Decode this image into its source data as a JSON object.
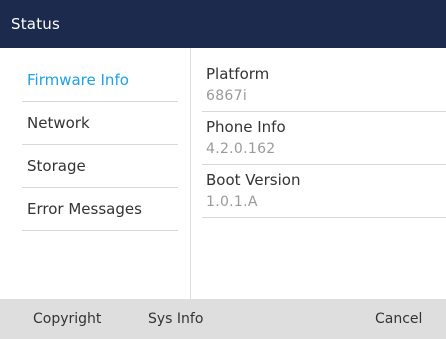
{
  "title": "Status",
  "menu": {
    "items": [
      {
        "label": "Firmware Info",
        "active": true
      },
      {
        "label": "Network",
        "active": false
      },
      {
        "label": "Storage",
        "active": false
      },
      {
        "label": "Error Messages",
        "active": false
      }
    ]
  },
  "details": [
    {
      "label": "Platform",
      "value": "6867i"
    },
    {
      "label": "Phone Info",
      "value": "4.2.0.162"
    },
    {
      "label": "Boot Version",
      "value": "1.0.1.A"
    }
  ],
  "softkeys": {
    "copyright": "Copyright",
    "sysinfo": "Sys Info",
    "cancel": "Cancel"
  },
  "colors": {
    "titlebar": "#1c2b4d",
    "active": "#1ea0e6",
    "softkey_bar": "#dedede"
  }
}
